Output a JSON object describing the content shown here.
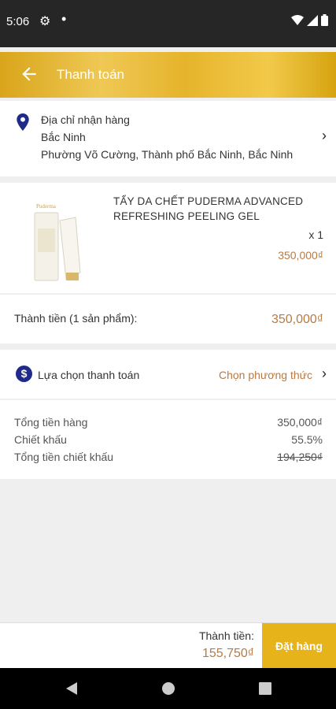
{
  "status_bar": {
    "time": "5:06"
  },
  "app_bar": {
    "title": "Thanh toán"
  },
  "address": {
    "label": "Địa chỉ nhận hàng",
    "city": "Bắc Ninh",
    "detail": "Phường Võ Cường, Thành phố Bắc Ninh, Bắc Ninh"
  },
  "product": {
    "name": "TẨY DA CHẾT PUDERMA ADVANCED REFRESHING PEELING GEL",
    "quantity": "x 1",
    "price": "350,000₫"
  },
  "subtotal": {
    "label": "Thành tiền (1 sản phẩm):",
    "value": "350,000₫"
  },
  "payment": {
    "label": "Lựa chọn thanh toán",
    "action": "Chọn phương thức"
  },
  "summary": {
    "rows": [
      {
        "label": "Tổng tiền hàng",
        "value": "350,000₫"
      },
      {
        "label": "Chiết khấu",
        "value": "55.5%"
      },
      {
        "label": "Tổng tiền chiết khấu",
        "value": "194,250₫"
      }
    ]
  },
  "footer": {
    "total_label": "Thành tiền:",
    "total_value": "155,750₫",
    "order_button": "Đặt hàng"
  },
  "colors": {
    "accent_gold": "#e7b31a",
    "price_brown": "#b77a43",
    "pin_blue": "#1f2a8a"
  }
}
